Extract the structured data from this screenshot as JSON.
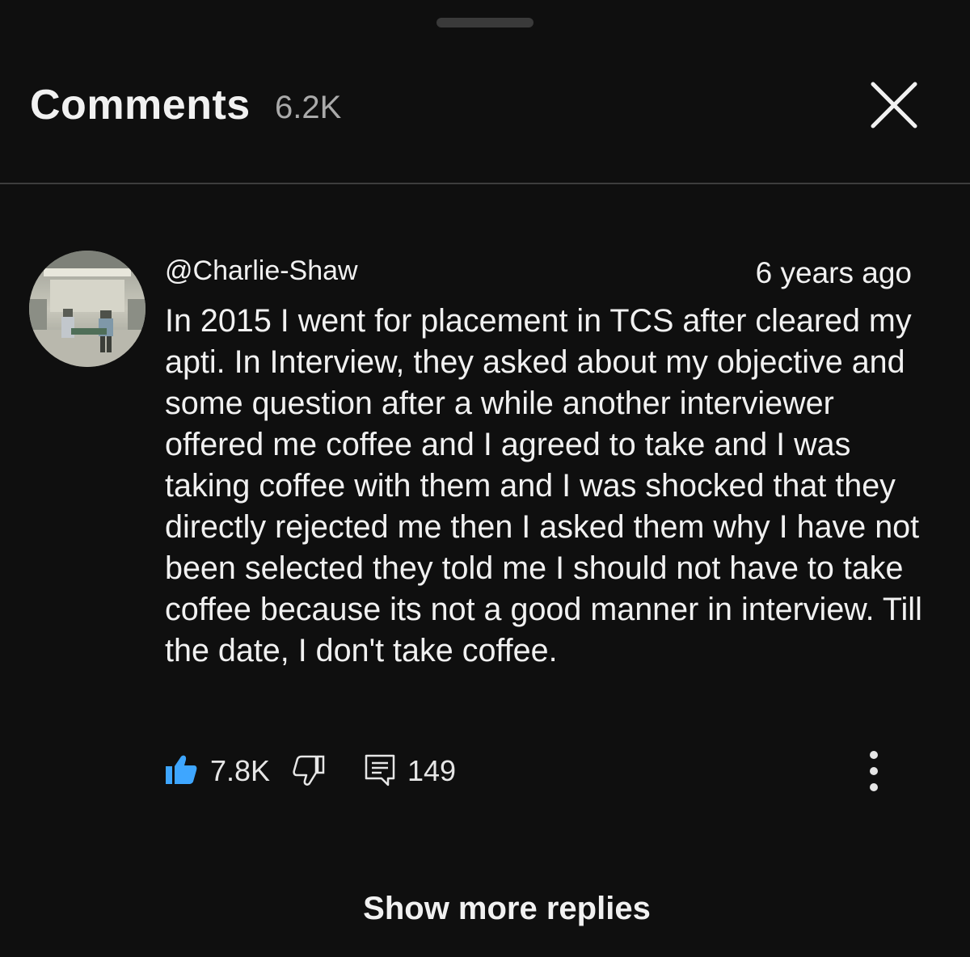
{
  "header": {
    "title": "Comments",
    "count": "6.2K",
    "close_icon": "close-icon"
  },
  "comment": {
    "author": "@Charlie-Shaw",
    "timestamp": "6 years ago",
    "text": "In 2015 I went for placement in TCS after cleared my apti. In Interview, they asked about my objective and some question after a while another interviewer offered me coffee and I agreed to take and I was taking coffee with them and I was shocked that they directly rejected me then I asked them why I have not been selected they told me I should not have to take coffee because its not a good manner in interview. Till the date, I don't take coffee.",
    "likes": "7.8K",
    "replies": "149",
    "icons": {
      "like": "thumbs-up-icon",
      "dislike": "thumbs-down-icon",
      "reply": "reply-icon",
      "more": "more-vert-icon"
    }
  },
  "footer": {
    "show_more": "Show more replies"
  },
  "colors": {
    "background": "#0f0f0f",
    "text": "#f1f1f1",
    "secondary_text": "#aaaaaa",
    "like_active": "#3ea6ff"
  }
}
